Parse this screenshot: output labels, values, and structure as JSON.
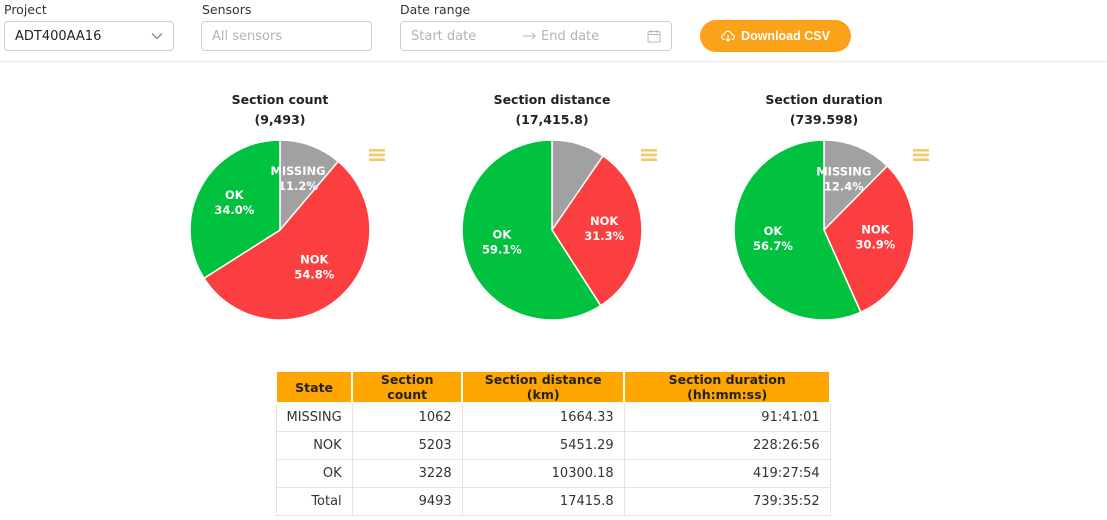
{
  "filters": {
    "project": {
      "label": "Project",
      "value": "ADT400AA16"
    },
    "sensors": {
      "label": "Sensors",
      "placeholder": "All sensors"
    },
    "date_range": {
      "label": "Date range",
      "start_placeholder": "Start date",
      "end_placeholder": "End date"
    },
    "download_label": "Download CSV"
  },
  "colors": {
    "MISSING": "#a1a1a1",
    "NOK": "#fb3f41",
    "OK": "#00c23f",
    "accent": "#faa31a",
    "menu": "#f5c86a"
  },
  "chart_data": [
    {
      "type": "pie",
      "title": "Section count",
      "total_label": "(9,493)",
      "slices": [
        {
          "name": "MISSING",
          "value": 11.2,
          "label": "11.2%"
        },
        {
          "name": "NOK",
          "value": 54.8,
          "label": "54.8%"
        },
        {
          "name": "OK",
          "value": 34.0,
          "label": "34.0%"
        }
      ]
    },
    {
      "type": "pie",
      "title": "Section distance",
      "total_label": "(17,415.8)",
      "slices": [
        {
          "name": "MISSING",
          "value": 9.6,
          "label": ""
        },
        {
          "name": "NOK",
          "value": 31.3,
          "label": "31.3%"
        },
        {
          "name": "OK",
          "value": 59.1,
          "label": "59.1%"
        }
      ]
    },
    {
      "type": "pie",
      "title": "Section duration",
      "total_label": "(739.598)",
      "slices": [
        {
          "name": "MISSING",
          "value": 12.4,
          "label": "12.4%"
        },
        {
          "name": "NOK",
          "value": 30.9,
          "label": "30.9%"
        },
        {
          "name": "OK",
          "value": 56.7,
          "label": "56.7%"
        }
      ]
    }
  ],
  "table": {
    "headers": [
      "State",
      "Section count",
      "Section distance (km)",
      "Section duration (hh:mm:ss)"
    ],
    "rows": [
      [
        "MISSING",
        "1062",
        "1664.33",
        "91:41:01"
      ],
      [
        "NOK",
        "5203",
        "5451.29",
        "228:26:56"
      ],
      [
        "OK",
        "3228",
        "10300.18",
        "419:27:54"
      ],
      [
        "Total",
        "9493",
        "17415.8",
        "739:35:52"
      ]
    ]
  }
}
